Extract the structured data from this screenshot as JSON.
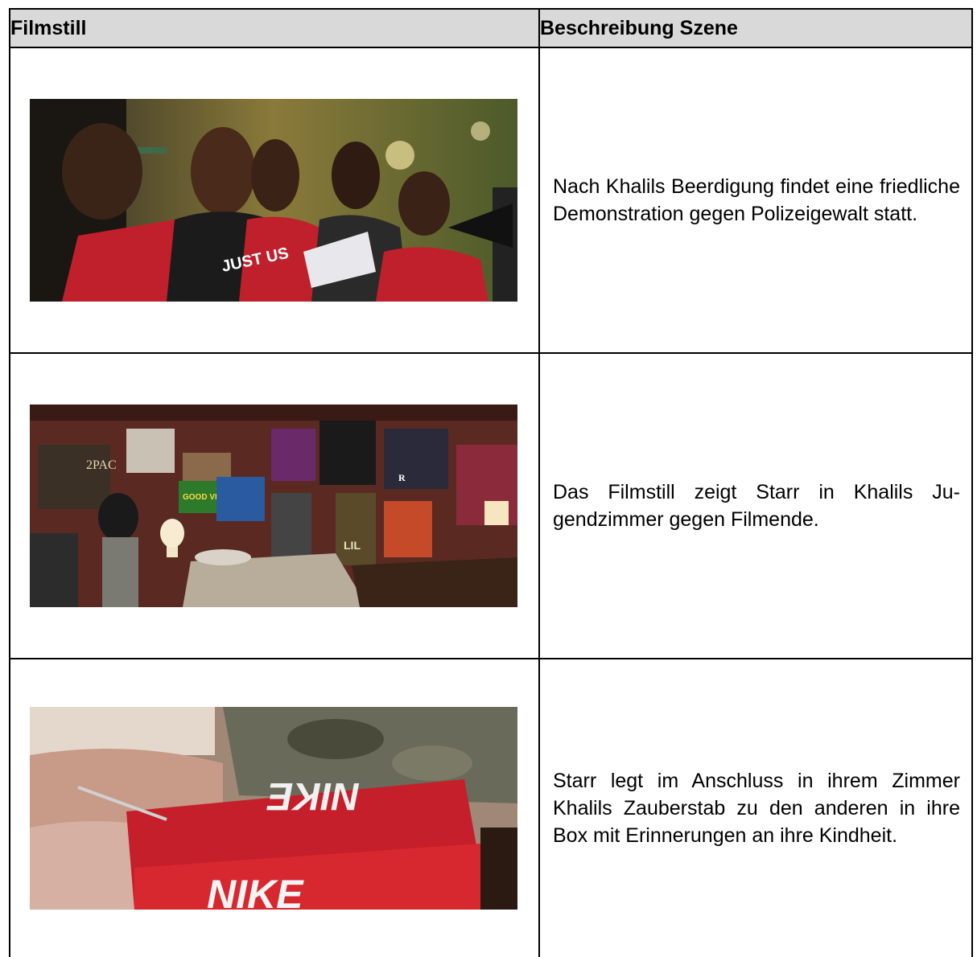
{
  "table": {
    "headers": [
      "Filmstill",
      "Beschreibung Szene"
    ],
    "rows": [
      {
        "still_icon": "demonstration-still",
        "description": "Nach Khalils Beerdigung findet eine friedliche Demonstration gegen Polizei­gewalt statt.",
        "sign_text": "JUST US"
      },
      {
        "still_icon": "bedroom-still",
        "description": "Das Filmstill zeigt Starr in Khalils Ju­gendzimmer gegen Filmende.",
        "poster_labels": [
          "2PAC",
          "GOOD VIBES",
          "R",
          "LIL"
        ]
      },
      {
        "still_icon": "shoebox-still",
        "description": "Starr legt im Anschluss in ihrem Zimmer Khalils Zauberstab zu den anderen in ihre Box mit Erinnerungen an ihre Kind­heit.",
        "box_text": "NIKE"
      }
    ]
  },
  "colors": {
    "header_bg": "#d9d9d9",
    "border": "#000000",
    "shirt_red": "#c0202b",
    "box_red": "#c41f2a"
  }
}
